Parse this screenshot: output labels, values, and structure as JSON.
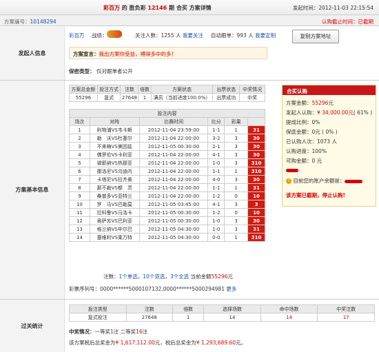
{
  "header": {
    "brand": "彩百万",
    "title_mid": "的 胜负彩",
    "issue": "12146",
    "title_suffix": "期 合买 方案详情",
    "pub_label": "发起时间：",
    "pub_time": "2012-11-03 22:15:54"
  },
  "subbar": {
    "plan_no_label": "方案编号：",
    "plan_no": "10148294",
    "stop_label": "认购截止时间：",
    "stop_value": "已截期"
  },
  "initiator": {
    "section_label": "发起人信息",
    "name": "彩百万",
    "record_label": "战绩：",
    "followers_label": "关注人数：",
    "followers": "1255",
    "followers_unit": "人",
    "follow_link": "我要关注",
    "auto_label": "自动跟单：",
    "auto_count": "993",
    "auto_unit": "人",
    "auto_link": "我要定制",
    "copy_button": "复制方案地址",
    "decl_label": "方案宣言：",
    "decl_text": "我出方案你受益，搏得多中的多！",
    "secret_label": "保密类型：",
    "secret_value": "仅对跟单者公开"
  },
  "basic": {
    "section_label": "方案基本信息",
    "summary_headers": [
      "方案总金额",
      "投注方式",
      "注数",
      "倍数",
      "方案状态",
      "出票状态",
      "中奖情况"
    ],
    "summary_values": [
      "55296",
      "复式",
      "27648",
      "1",
      "满员（当前进度100.0%）",
      "出票成功",
      "中奖"
    ],
    "content_title": "投注内容",
    "match_headers": [
      "场次",
      "对阵",
      "比赛时间",
      "比分",
      "彩果",
      ""
    ],
    "matches": [
      {
        "no": "1",
        "vs": "利物浦VS韦卡斯",
        "time": "2012-11-04 23:59:00",
        "score": "1-1",
        "result": "1",
        "pick": "31"
      },
      {
        "no": "2",
        "vs": "勒　沃VS杜塞尔",
        "time": "2012-11-04 22:00:00",
        "score": "3-2",
        "result": "3",
        "pick": "30"
      },
      {
        "no": "3",
        "vs": "不来梅VS美因兹",
        "time": "2012-11-05 00:30:00",
        "score": "2-1",
        "result": "3",
        "pick": "30"
      },
      {
        "no": "4",
        "vs": "佛罗伦VS卡利亚",
        "time": "2012-11-04 22:00:00",
        "score": "4-1",
        "result": "3",
        "pick": "30"
      },
      {
        "no": "5",
        "vs": "锡耶纳VS热那亚",
        "time": "2012-11-04 22:00:00",
        "score": "1-0",
        "result": "3",
        "pick": "310"
      },
      {
        "no": "6",
        "vs": "挪洛尼VS乌迪内",
        "time": "2012-11-04 22:00:00",
        "score": "1-1",
        "result": "1",
        "pick": "310"
      },
      {
        "no": "7",
        "vs": "卡塔尼VS拉齐奥",
        "time": "2012-11-04 22:00:00",
        "score": "4-0",
        "result": "3",
        "pick": "30"
      },
      {
        "no": "8",
        "vs": "那不勒VS都　灵",
        "time": "2012-11-04 22:00:00",
        "score": "1-1",
        "result": "1",
        "pick": "31"
      },
      {
        "no": "9",
        "vs": "桑普多VS亚特兰",
        "time": "2012-11-04 22:00:00",
        "score": "1-2",
        "result": "0",
        "pick": "10"
      },
      {
        "no": "10",
        "vs": "罗　马VS巴勒莫",
        "time": "2012-11-05 03:45:00",
        "score": "4-1",
        "result": "3",
        "pick": "3"
      },
      {
        "no": "11",
        "vs": "拉科鲁VS马洛卡",
        "time": "2012-11-05 00:30:00",
        "score": "1-2",
        "result": "0",
        "pick": "10"
      },
      {
        "no": "12",
        "vs": "奥萨苏VS巴利亚",
        "time": "2012-11-05 00:30:00",
        "score": "1-0",
        "result": "3",
        "pick": "30"
      },
      {
        "no": "13",
        "vs": "格兰纳VS毕尔巴",
        "time": "2012-11-05 04:30:00",
        "score": "1-0",
        "result": "3",
        "pick": "31"
      },
      {
        "no": "14",
        "vs": "塞维利VS莱万特",
        "time": "2012-11-05 04:30:00",
        "score": "0-0",
        "result": "1",
        "pick": "310"
      }
    ],
    "tally_a": "注数：",
    "tally_single": "1个单选",
    "tally_b": "，",
    "tally_double": "10个双选",
    "tally_c": "，",
    "tally_triple": "3个全选",
    "tally_d": " 当前金额",
    "tally_amount": "55296",
    "tally_unit": "元",
    "ticket_label": "彩票序列号：",
    "ticket_value": "0000******5000107132,0000******5000294981",
    "ticket_more": "更多"
  },
  "buy": {
    "header": "合买认购",
    "total_label": "方案金额：",
    "total": "55296",
    "total_unit": "元",
    "init_label": "发起人认购：",
    "init_value": "¥ 34,000.00元",
    "init_pct": "( 61% )",
    "reward_label": "提成比例：",
    "reward_value": "0%",
    "guard_label": "保底金额：",
    "guard_value": "0元 ( 0% )",
    "buyers_label": "已认购人次：",
    "buyers_value": "1073 人",
    "progress_label": "认购进度：",
    "progress_value": "100%",
    "left_label": "可购金额：",
    "left_value": "0 元",
    "balance_text": "目前您的账户余额是：",
    "closed_text": "该方案已截期，停止认购!"
  },
  "stats": {
    "section_label": "过关统计",
    "headers": [
      "投注类型",
      "注数",
      "倍数",
      "选择场数",
      "命中场数",
      "中奖注数"
    ],
    "values": [
      "复式投注",
      "27648",
      "1",
      "14",
      "14",
      "17"
    ],
    "win_label": "中奖情况：",
    "win_a": "一等奖",
    "win_first": "1",
    "win_b": "注 二等奖",
    "win_second": "16",
    "win_c": "注",
    "bonus_a": "该方案税后总奖金为",
    "bonus_total": "¥ 1,617,112.00",
    "bonus_b": "元，税后总奖金为",
    "bonus_after": "¥ 1,293,689.60",
    "bonus_c": "元。"
  },
  "colors": {
    "accent": "#d00000",
    "header_red": "#c8171a",
    "pick_bg": "#d21b12"
  }
}
